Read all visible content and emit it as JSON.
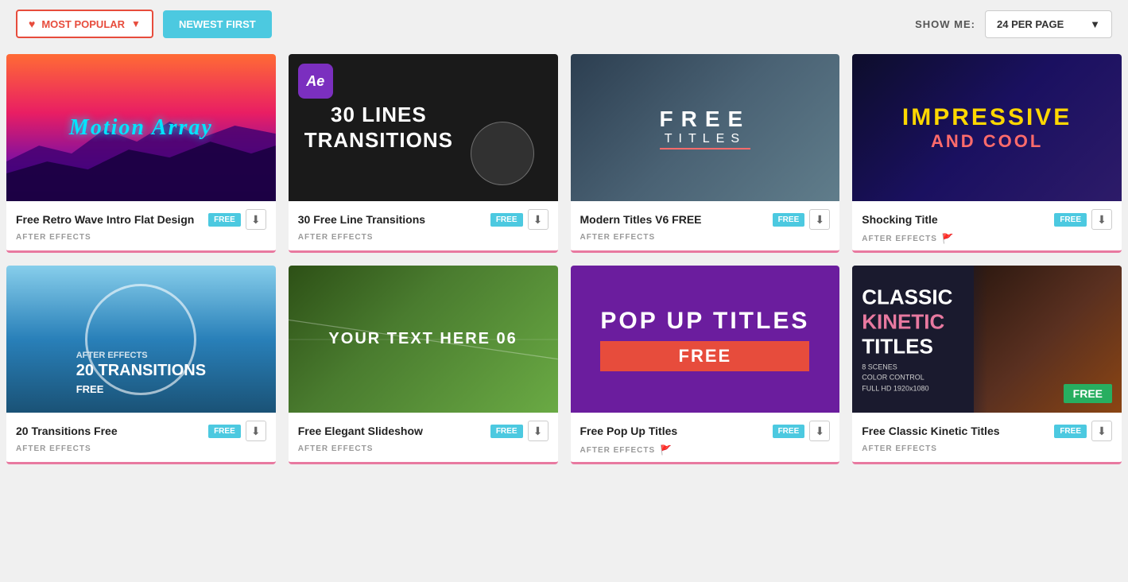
{
  "toolbar": {
    "filter_label": "MOST POPULAR",
    "newest_label": "NEWEST FIRST",
    "show_me_label": "SHOW ME:",
    "per_page_label": "24 PER PAGE"
  },
  "cards": [
    {
      "id": 1,
      "title": "Free Retro Wave Intro Flat Design",
      "category": "AFTER EFFECTS",
      "badge": "FREE",
      "thumb_type": "retro-wave",
      "thumb_text": "MOTION ARRAY",
      "has_flag": false
    },
    {
      "id": 2,
      "title": "30 Free Line Transitions",
      "category": "AFTER EFFECTS",
      "badge": "FREE",
      "thumb_type": "line-transitions",
      "thumb_text": "30 LINES TRANSITIONS",
      "has_flag": false
    },
    {
      "id": 3,
      "title": "Modern Titles V6 FREE",
      "category": "AFTER EFFECTS",
      "badge": "FREE",
      "thumb_type": "modern-titles",
      "thumb_line1": "FREE",
      "thumb_line2": "TITLES",
      "has_flag": false
    },
    {
      "id": 4,
      "title": "Shocking Title",
      "category": "AFTER EFFECTS",
      "badge": "FREE",
      "thumb_type": "shocking-title",
      "thumb_line1": "IMPRESSIVE",
      "thumb_line2": "AND COOL",
      "has_flag": true,
      "flag": "🚩"
    },
    {
      "id": 5,
      "title": "20 Transitions Free",
      "category": "AFTER EFFECTS",
      "badge": "FREE",
      "thumb_type": "transitions-20",
      "thumb_text": "20 TRANSITIONS FREE",
      "has_flag": false
    },
    {
      "id": 6,
      "title": "Free Elegant Slideshow",
      "category": "AFTER EFFECTS",
      "badge": "FREE",
      "thumb_type": "elegant-slideshow",
      "thumb_text": "YOUR TEXT HERE 06",
      "has_flag": false
    },
    {
      "id": 7,
      "title": "Free Pop Up Titles",
      "category": "AFTER EFFECTS",
      "badge": "FREE",
      "thumb_type": "pop-up-titles",
      "thumb_line1": "POP UP TITLES",
      "thumb_line2": "FREE",
      "has_flag": true,
      "flag": "🚩"
    },
    {
      "id": 8,
      "title": "Free Classic Kinetic Titles",
      "category": "AFTER EFFECTS",
      "badge": "FREE",
      "thumb_type": "kinetic-titles",
      "has_flag": false
    }
  ]
}
